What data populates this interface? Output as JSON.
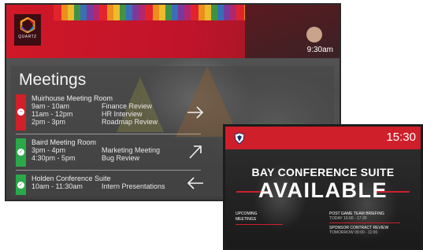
{
  "screen1": {
    "logo_text": "QUARTZ",
    "time": "9:30am",
    "title": "Meetings",
    "colors": {
      "busy": "#d0202a",
      "available": "#2aa84a",
      "header": "#d01828"
    },
    "rooms": [
      {
        "name": "Muirhouse Meeting Room",
        "status_icon": "minus-circle-icon",
        "arrow_icon": "arrow-right-icon",
        "slots": [
          {
            "time": "9am - 10am",
            "title": "Finance Review"
          },
          {
            "time": "11am - 12pm",
            "title": "HR Interview"
          },
          {
            "time": "2pm - 3pm",
            "title": "Roadmap Review"
          }
        ]
      },
      {
        "name": "Baird Meeting Room",
        "status_icon": "check-circle-icon",
        "arrow_icon": "arrow-up-right-icon",
        "slots": [
          {
            "time": "3pm - 4pm",
            "title": "Marketing Meeting"
          },
          {
            "time": "4:30pm - 5pm",
            "title": "Bug Review"
          }
        ]
      },
      {
        "name": "Holden Conference Suite",
        "status_icon": "check-circle-icon",
        "arrow_icon": "arrow-left-icon",
        "slots": [
          {
            "time": "10am - 11:30am",
            "title": "Intern Presentations"
          }
        ]
      }
    ]
  },
  "screen2": {
    "time": "15:30",
    "room_name": "BAY CONFERENCE SUITE",
    "status": "AVAILABLE",
    "upcoming_label_1": "UPCOMING",
    "upcoming_label_2": "MEETINGS",
    "events": [
      {
        "title": "POST GAME TEAM BRIEFING",
        "when": "TODAY 16:00 - 17:30"
      },
      {
        "title": "SPONSOR CONTRACT REVIEW",
        "when": "TOMORROW 09:00 - 11:00"
      }
    ],
    "logo_icon": "crest-logo-icon"
  }
}
